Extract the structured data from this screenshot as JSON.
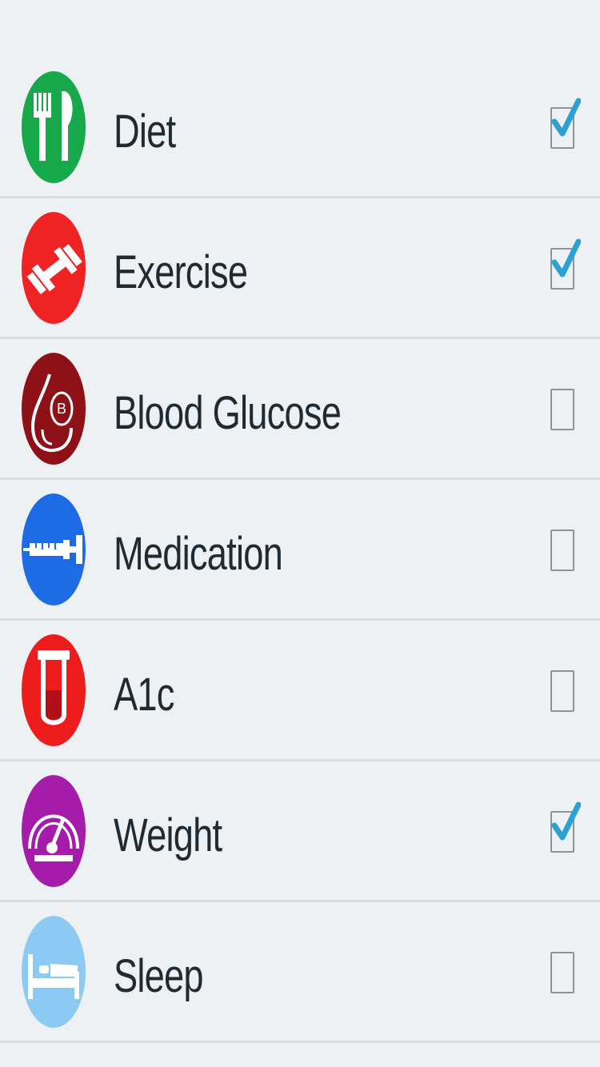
{
  "items": [
    {
      "label": "Diet",
      "checked": true,
      "icon": "fork-knife-icon",
      "color": "#16a84a"
    },
    {
      "label": "Exercise",
      "checked": true,
      "icon": "dumbbell-icon",
      "color": "#ef2323"
    },
    {
      "label": "Blood Glucose",
      "checked": false,
      "icon": "blood-drop-icon",
      "color": "#8f1118"
    },
    {
      "label": "Medication",
      "checked": false,
      "icon": "syringe-icon",
      "color": "#1e6be6"
    },
    {
      "label": "A1c",
      "checked": false,
      "icon": "test-tube-icon",
      "color": "#ee1d1d"
    },
    {
      "label": "Weight",
      "checked": true,
      "icon": "scale-gauge-icon",
      "color": "#a51cab"
    },
    {
      "label": "Sleep",
      "checked": false,
      "icon": "bed-icon",
      "color": "#8ccaf3"
    }
  ],
  "checkbox_color": "#2aa3d2",
  "background_color": "#edf1f3",
  "divider_color": "#d7dde1"
}
